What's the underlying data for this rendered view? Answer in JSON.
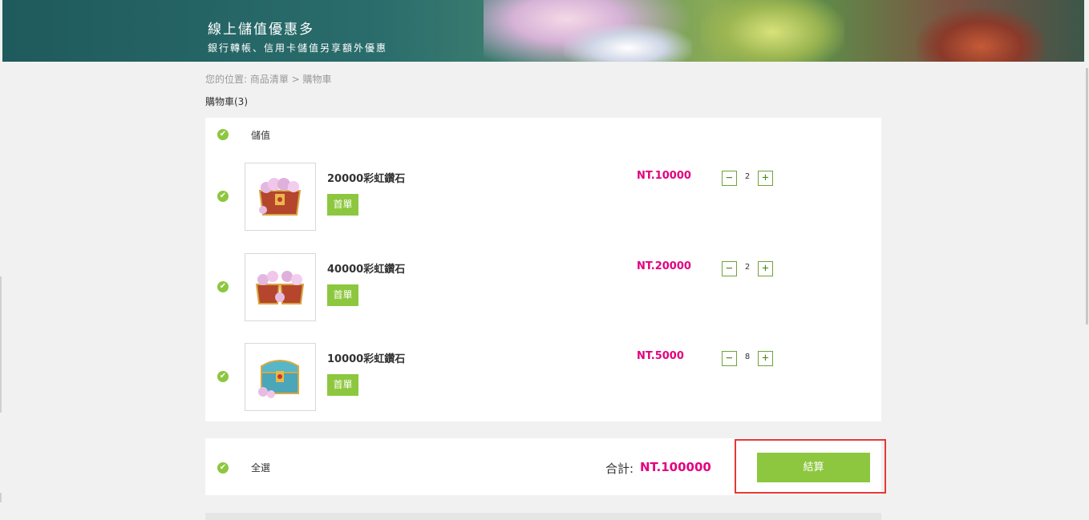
{
  "banner": {
    "title": "線上儲值優惠多",
    "subtitle": "銀行轉帳、信用卡儲值另享額外優惠"
  },
  "breadcrumb": "您的位置: 商品清單 > 購物車",
  "cart_count": "購物車(3)",
  "group": {
    "label": "儲值"
  },
  "items": [
    {
      "name": "20000彩虹鑽石",
      "tag": "首單",
      "price": "NT.10000",
      "qty": "2",
      "minus": "−",
      "plus": "+"
    },
    {
      "name": "40000彩虹鑽石",
      "tag": "首單",
      "price": "NT.20000",
      "qty": "2",
      "minus": "−",
      "plus": "+"
    },
    {
      "name": "10000彩虹鑽石",
      "tag": "首單",
      "price": "NT.5000",
      "qty": "8",
      "minus": "−",
      "plus": "+"
    }
  ],
  "footer": {
    "select_all": "全選",
    "total_label": "合計:",
    "total_value": "NT.100000",
    "checkout": "結算"
  },
  "icons": {
    "check": "check-circle-icon",
    "minus": "minus-icon",
    "plus": "plus-icon"
  },
  "colors": {
    "accent_green": "#8dc73f",
    "price_magenta": "#e4007f",
    "highlight_red": "#e53935"
  }
}
